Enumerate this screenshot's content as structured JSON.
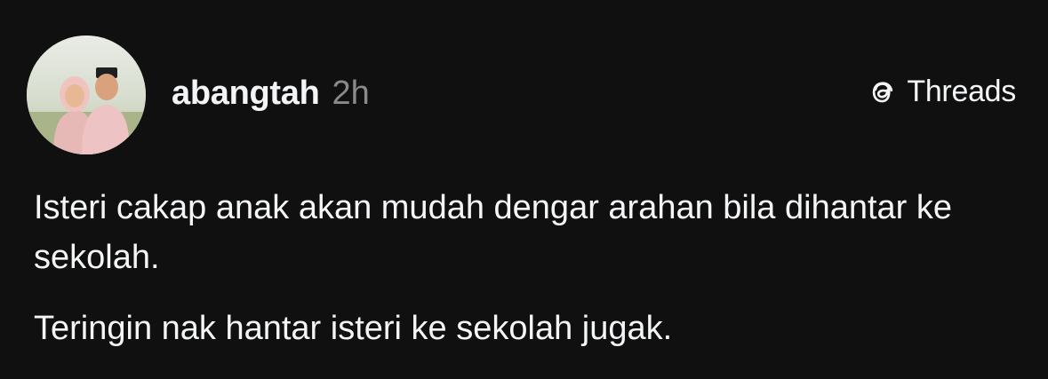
{
  "post": {
    "author": {
      "username": "abangtah",
      "timestamp": "2h",
      "avatar_icon": "profile-photo"
    },
    "brand": {
      "icon": "threads-logo-icon",
      "name": "Threads"
    },
    "paragraphs": [
      "Isteri cakap anak akan mudah dengar arahan bila dihantar ke sekolah.",
      "Teringin nak hantar isteri ke sekolah jugak."
    ]
  },
  "colors": {
    "background": "#101010",
    "primary_text": "#f3f5f7",
    "secondary_text": "#8a8a8a"
  }
}
